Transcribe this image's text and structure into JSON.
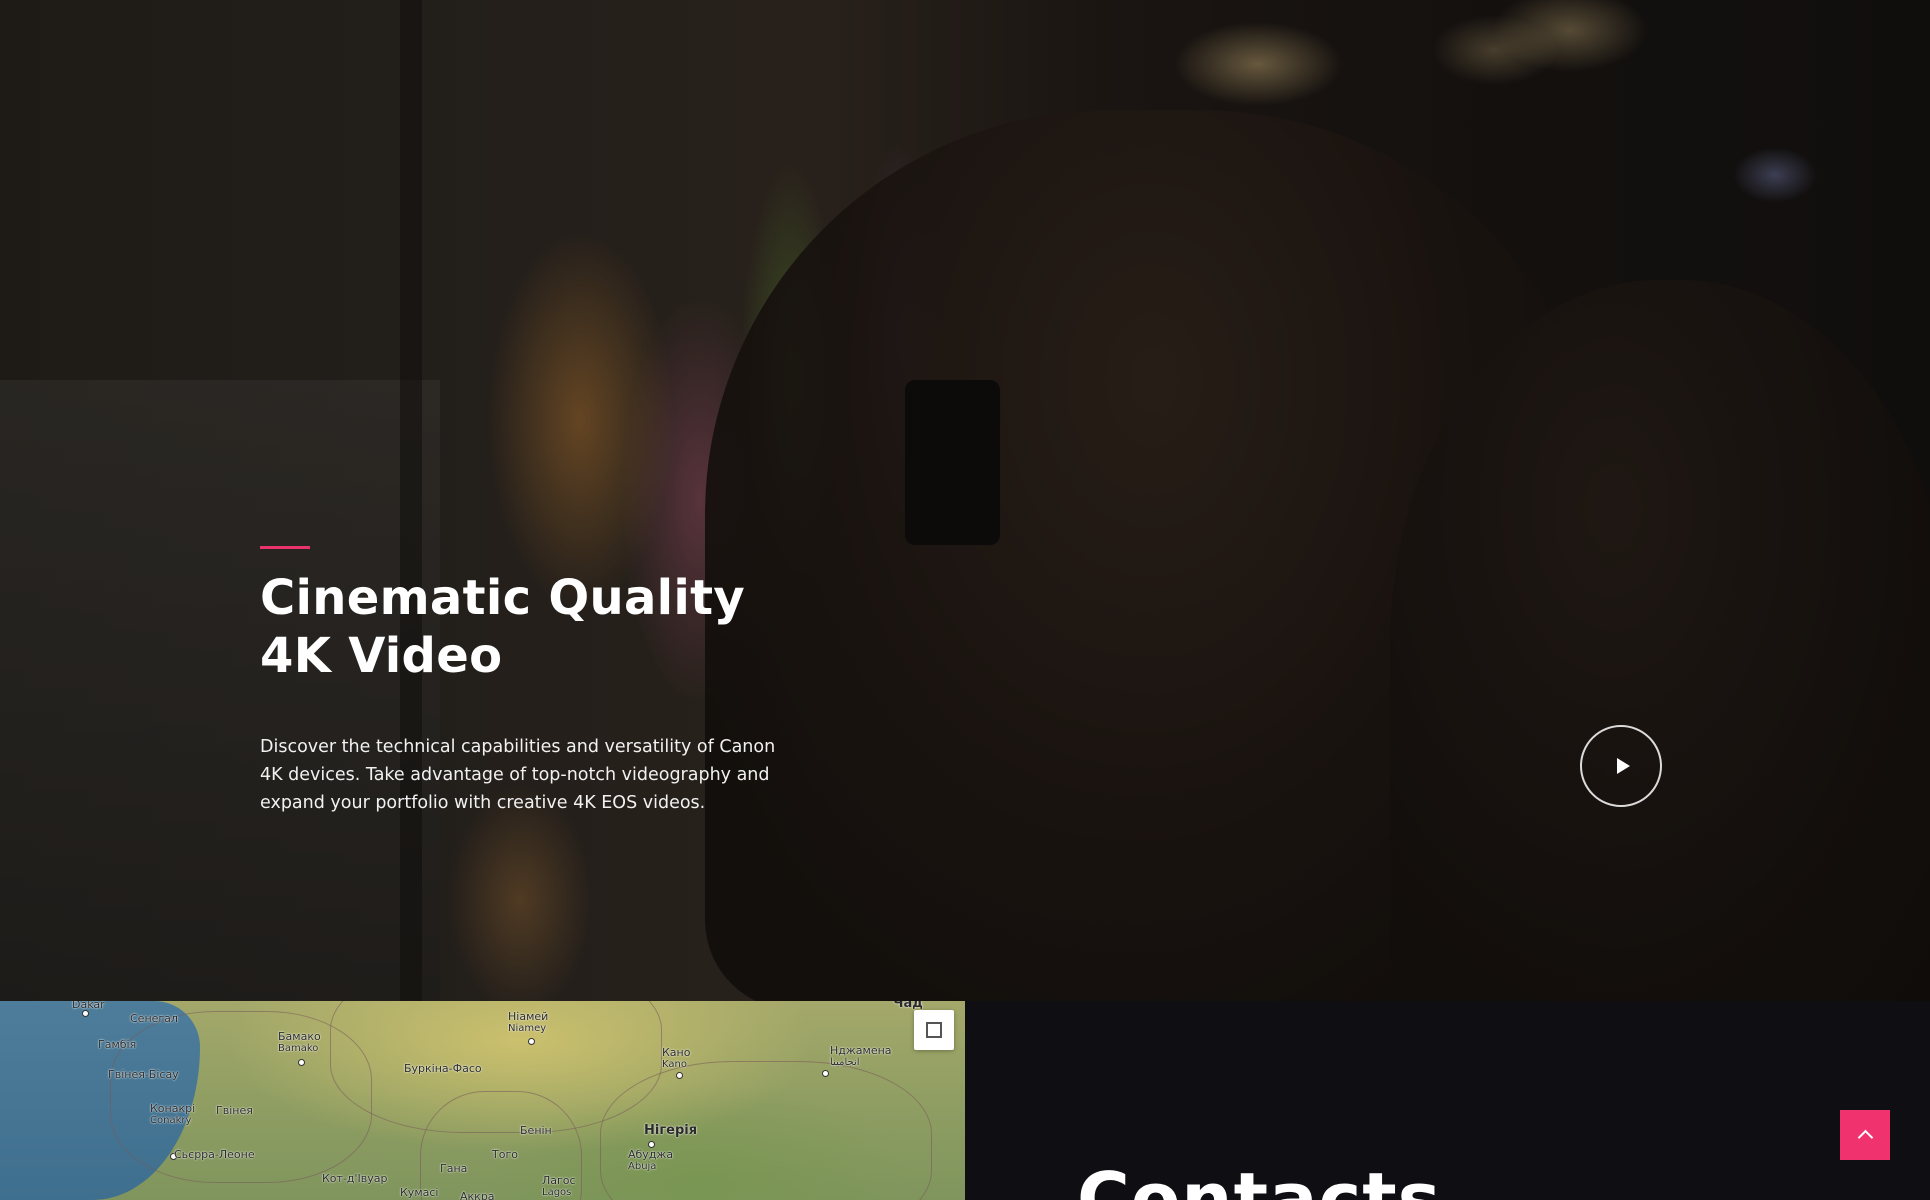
{
  "hero": {
    "title_line1": "Cinematic Quality",
    "title_line2": "4K Video",
    "description": "Discover the technical capabilities and versatility of Canon 4K devices. Take advantage of top-notch videography and expand your portfolio with creative 4K EOS videos.",
    "play_icon": "play-icon"
  },
  "map": {
    "labels": [
      {
        "name": "Dakar",
        "text": "Dakar"
      },
      {
        "name": "senegal",
        "text": "Сенегал"
      },
      {
        "name": "gambia",
        "text": "Гамбія"
      },
      {
        "name": "guinea-bissau",
        "text": "Гвінея-Бісау"
      },
      {
        "name": "conakry",
        "text": "Конакрі",
        "sub": "Conakry"
      },
      {
        "name": "guinea",
        "text": "Гвінея"
      },
      {
        "name": "sierra-leone",
        "text": "Сьєрра-Леоне"
      },
      {
        "name": "bamako",
        "text": "Бамако",
        "sub": "Bamako"
      },
      {
        "name": "burkina-faso",
        "text": "Буркіна-Фасо"
      },
      {
        "name": "niamey",
        "text": "Ніамей",
        "sub": "Niamey"
      },
      {
        "name": "chad",
        "text": "Чад"
      },
      {
        "name": "kano",
        "text": "Кано",
        "sub": "Kano"
      },
      {
        "name": "ndjamena",
        "text": "Нджамена",
        "sub": "انجامينا"
      },
      {
        "name": "benin",
        "text": "Бенін"
      },
      {
        "name": "nigeria",
        "text": "Нігерія"
      },
      {
        "name": "abuja",
        "text": "Абуджа",
        "sub": "Abuja"
      },
      {
        "name": "togo",
        "text": "Того"
      },
      {
        "name": "ghana",
        "text": "Гана"
      },
      {
        "name": "cote-divoire",
        "text": "Кот-д'Івуар"
      },
      {
        "name": "lagos",
        "text": "Лагос",
        "sub": "Lagos"
      },
      {
        "name": "kumasi",
        "text": "Кумасі"
      },
      {
        "name": "accra",
        "text": "Аккра"
      }
    ],
    "fullscreen_icon": "fullscreen-icon"
  },
  "contacts": {
    "title": "Contacts"
  },
  "scroll_top_icon": "chevron-up-icon",
  "colors": {
    "accent": "#e8336c",
    "scroll_top_bg": "#f0326f",
    "dark_panel": "#0f0f13"
  }
}
